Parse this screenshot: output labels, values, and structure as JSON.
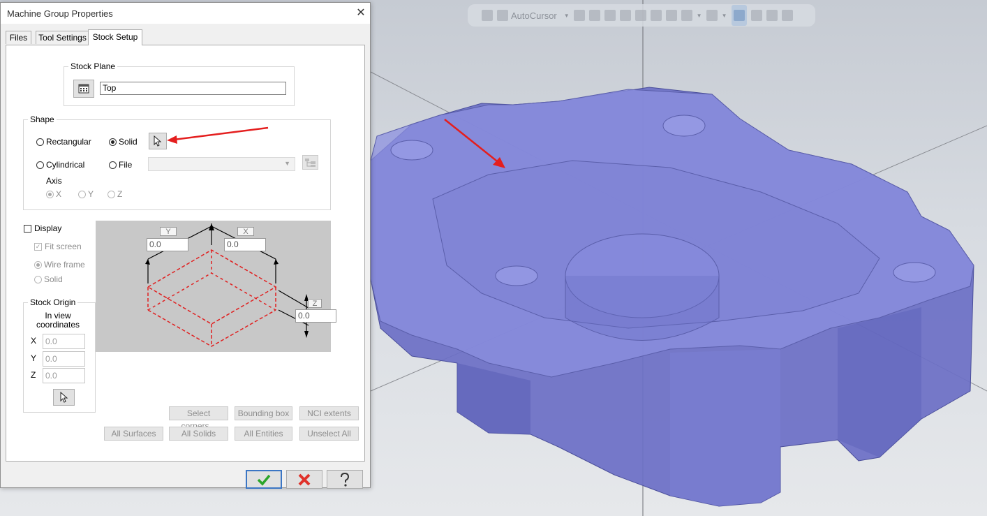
{
  "dialog": {
    "title": "Machine Group Properties",
    "close_glyph": "✕",
    "tabs": [
      {
        "label": "Files",
        "active": false
      },
      {
        "label": "Tool Settings",
        "active": false
      },
      {
        "label": "Stock Setup",
        "active": true
      }
    ]
  },
  "stock_plane": {
    "legend": "Stock Plane",
    "value": "Top",
    "icon": "plane-select-icon"
  },
  "shape": {
    "legend": "Shape",
    "options": {
      "rectangular": {
        "label": "Rectangular",
        "selected": false
      },
      "solid": {
        "label": "Solid",
        "selected": true
      },
      "cylindrical": {
        "label": "Cylindrical",
        "selected": false
      },
      "file": {
        "label": "File",
        "selected": false
      }
    },
    "file_value": "",
    "axis": {
      "label": "Axis",
      "options": [
        {
          "label": "X",
          "selected": true
        },
        {
          "label": "Y",
          "selected": false
        },
        {
          "label": "Z",
          "selected": false
        }
      ]
    }
  },
  "display": {
    "label": "Display",
    "checked": false,
    "fit_screen": {
      "label": "Fit screen",
      "checked": true
    },
    "wire_frame": {
      "label": "Wire frame",
      "selected": true
    },
    "solid": {
      "label": "Solid",
      "selected": false
    }
  },
  "stock_origin": {
    "legend": "Stock Origin",
    "caption": "In view coordinates",
    "x": {
      "label": "X",
      "value": "0.0"
    },
    "y": {
      "label": "Y",
      "value": "0.0"
    },
    "z": {
      "label": "Z",
      "value": "0.0"
    }
  },
  "preview": {
    "y_label": "Y",
    "x_label": "X",
    "z_label": "Z",
    "y_value": "0.0",
    "x_value": "0.0",
    "z_value": "0.0"
  },
  "buttons": {
    "select_corners": "Select corners...",
    "bounding_box": "Bounding box",
    "nci_extents": "NCI extents",
    "all_surfaces": "All Surfaces",
    "all_solids": "All Solids",
    "all_entities": "All Entities",
    "unselect_all": "Unselect All"
  },
  "toolbar": {
    "autocursor_label": "AutoCursor"
  },
  "colors": {
    "solid_fill": "#6b6fc6",
    "annotation_arrow": "#e41e1e",
    "ok_check": "#2aa52a",
    "cancel_x": "#e0322b"
  }
}
